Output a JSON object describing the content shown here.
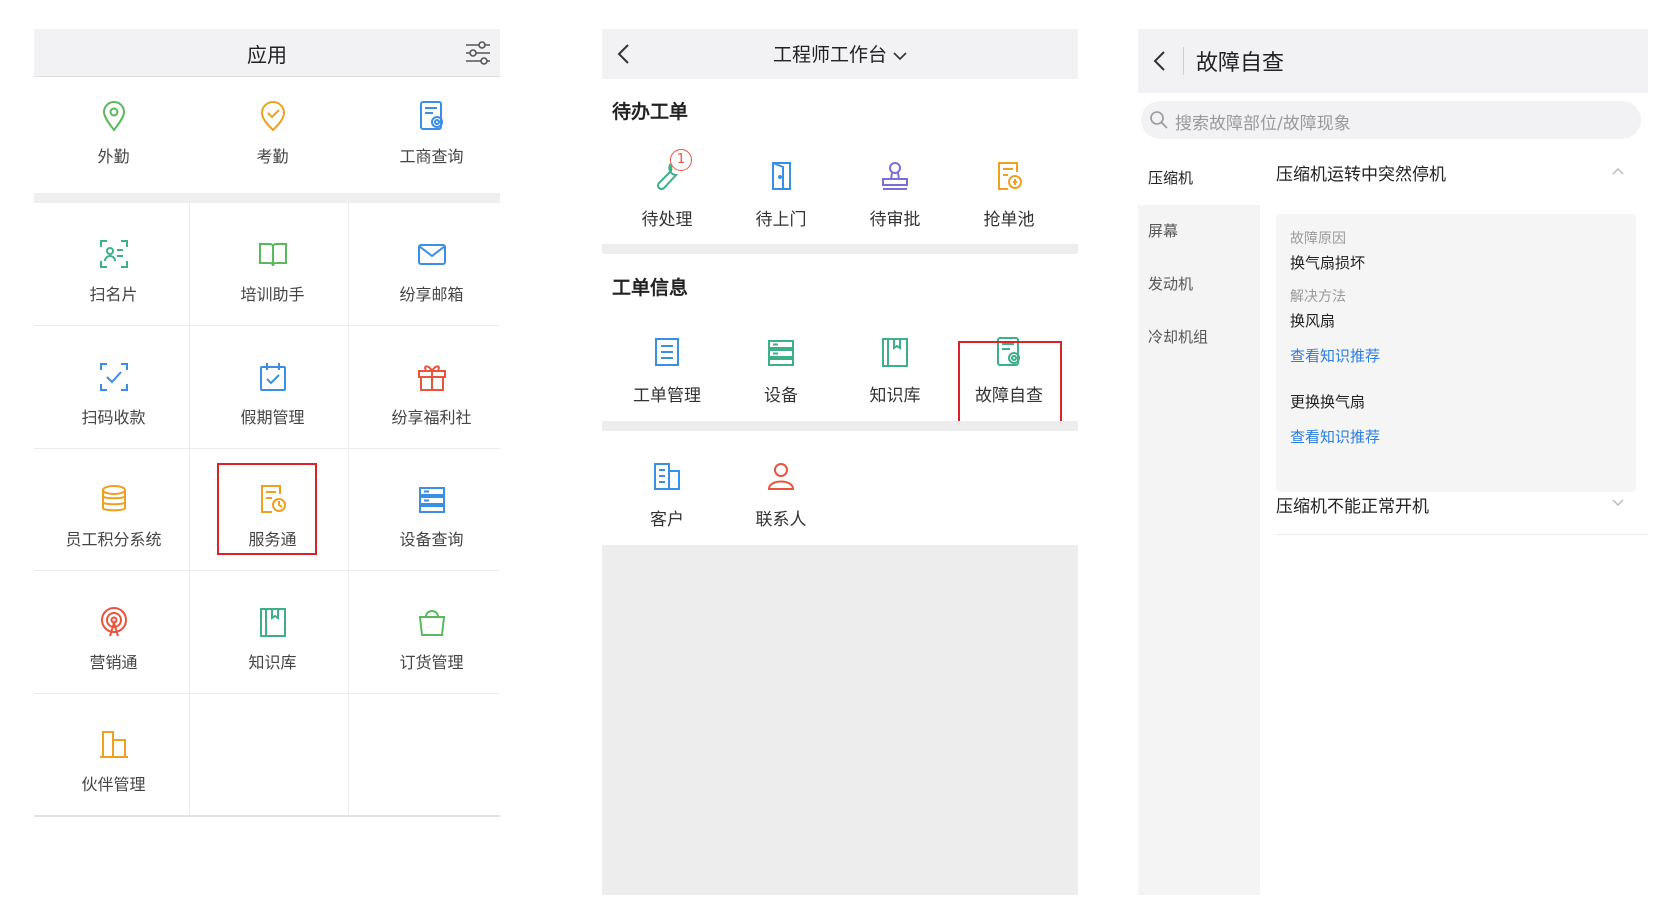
{
  "colors": {
    "highlight_box": "#d9232a",
    "link": "#2a7de1",
    "header_bg": "#f2f2f4"
  },
  "apps_panel": {
    "title": "应用",
    "settings_icon": "sliders-icon",
    "top_items": [
      {
        "label": "外勤",
        "icon": "location-pin-icon",
        "color": "#5cb85c"
      },
      {
        "label": "考勤",
        "icon": "check-circle-icon",
        "color": "#f0a020"
      },
      {
        "label": "工商查询",
        "icon": "document-search-icon",
        "color": "#3a8ee6"
      }
    ],
    "grid_items": [
      {
        "label": "扫名片",
        "icon": "scan-card-icon",
        "color": "#3db08a"
      },
      {
        "label": "培训助手",
        "icon": "book-icon",
        "color": "#5cb85c"
      },
      {
        "label": "纷享邮箱",
        "icon": "mail-icon",
        "color": "#3a8ee6"
      },
      {
        "label": "扫码收款",
        "icon": "scan-pay-icon",
        "color": "#3a8ee6"
      },
      {
        "label": "假期管理",
        "icon": "calendar-check-icon",
        "color": "#3a8ee6"
      },
      {
        "label": "纷享福利社",
        "icon": "gift-icon",
        "color": "#e8543c"
      },
      {
        "label": "员工积分系统",
        "icon": "coins-icon",
        "color": "#f0a020"
      },
      {
        "label": "服务通",
        "icon": "service-doc-icon",
        "color": "#f0a020"
      },
      {
        "label": "设备查询",
        "icon": "server-icon",
        "color": "#3a8ee6"
      },
      {
        "label": "营销通",
        "icon": "broadcast-icon",
        "color": "#e8543c"
      },
      {
        "label": "知识库",
        "icon": "knowledge-book-icon",
        "color": "#3db08a"
      },
      {
        "label": "订货管理",
        "icon": "shopping-bag-icon",
        "color": "#5cb85c"
      },
      {
        "label": "伙伴管理",
        "icon": "buildings-icon",
        "color": "#f0a020"
      }
    ]
  },
  "workbench_panel": {
    "title": "工程师工作台",
    "pending_section": "待办工单",
    "pending_items": [
      {
        "label": "待处理",
        "icon": "wrench-icon",
        "color": "#3db08a",
        "badge": "1"
      },
      {
        "label": "待上门",
        "icon": "door-icon",
        "color": "#3a8ee6"
      },
      {
        "label": "待审批",
        "icon": "stamp-icon",
        "color": "#7a6fd6"
      },
      {
        "label": "抢单池",
        "icon": "grab-order-icon",
        "color": "#f0a020"
      }
    ],
    "info_section": "工单信息",
    "info_items": [
      {
        "label": "工单管理",
        "icon": "list-doc-icon",
        "color": "#3a8ee6"
      },
      {
        "label": "设备",
        "icon": "server-icon",
        "color": "#3db08a"
      },
      {
        "label": "知识库",
        "icon": "knowledge-book-icon",
        "color": "#3db08a"
      },
      {
        "label": "故障自查",
        "icon": "document-search-icon",
        "color": "#3db08a"
      }
    ],
    "other_items": [
      {
        "label": "客户",
        "icon": "building-icon",
        "color": "#3a8ee6"
      },
      {
        "label": "联系人",
        "icon": "person-icon",
        "color": "#e8543c"
      }
    ]
  },
  "fault_panel": {
    "title": "故障自查",
    "search_placeholder": "搜索故障部位/故障现象",
    "categories": [
      "压缩机",
      "屏幕",
      "发动机",
      "冷却机组"
    ],
    "expanded_question": "压缩机运转中突然停机",
    "card": {
      "cause_label": "故障原因",
      "cause_value": "换气扇损坏",
      "method_label": "解决方法",
      "method_value": "换风扇",
      "link1": "查看知识推荐",
      "extra": "更换换气扇",
      "link2": "查看知识推荐"
    },
    "collapsed_question": "压缩机不能正常开机"
  }
}
